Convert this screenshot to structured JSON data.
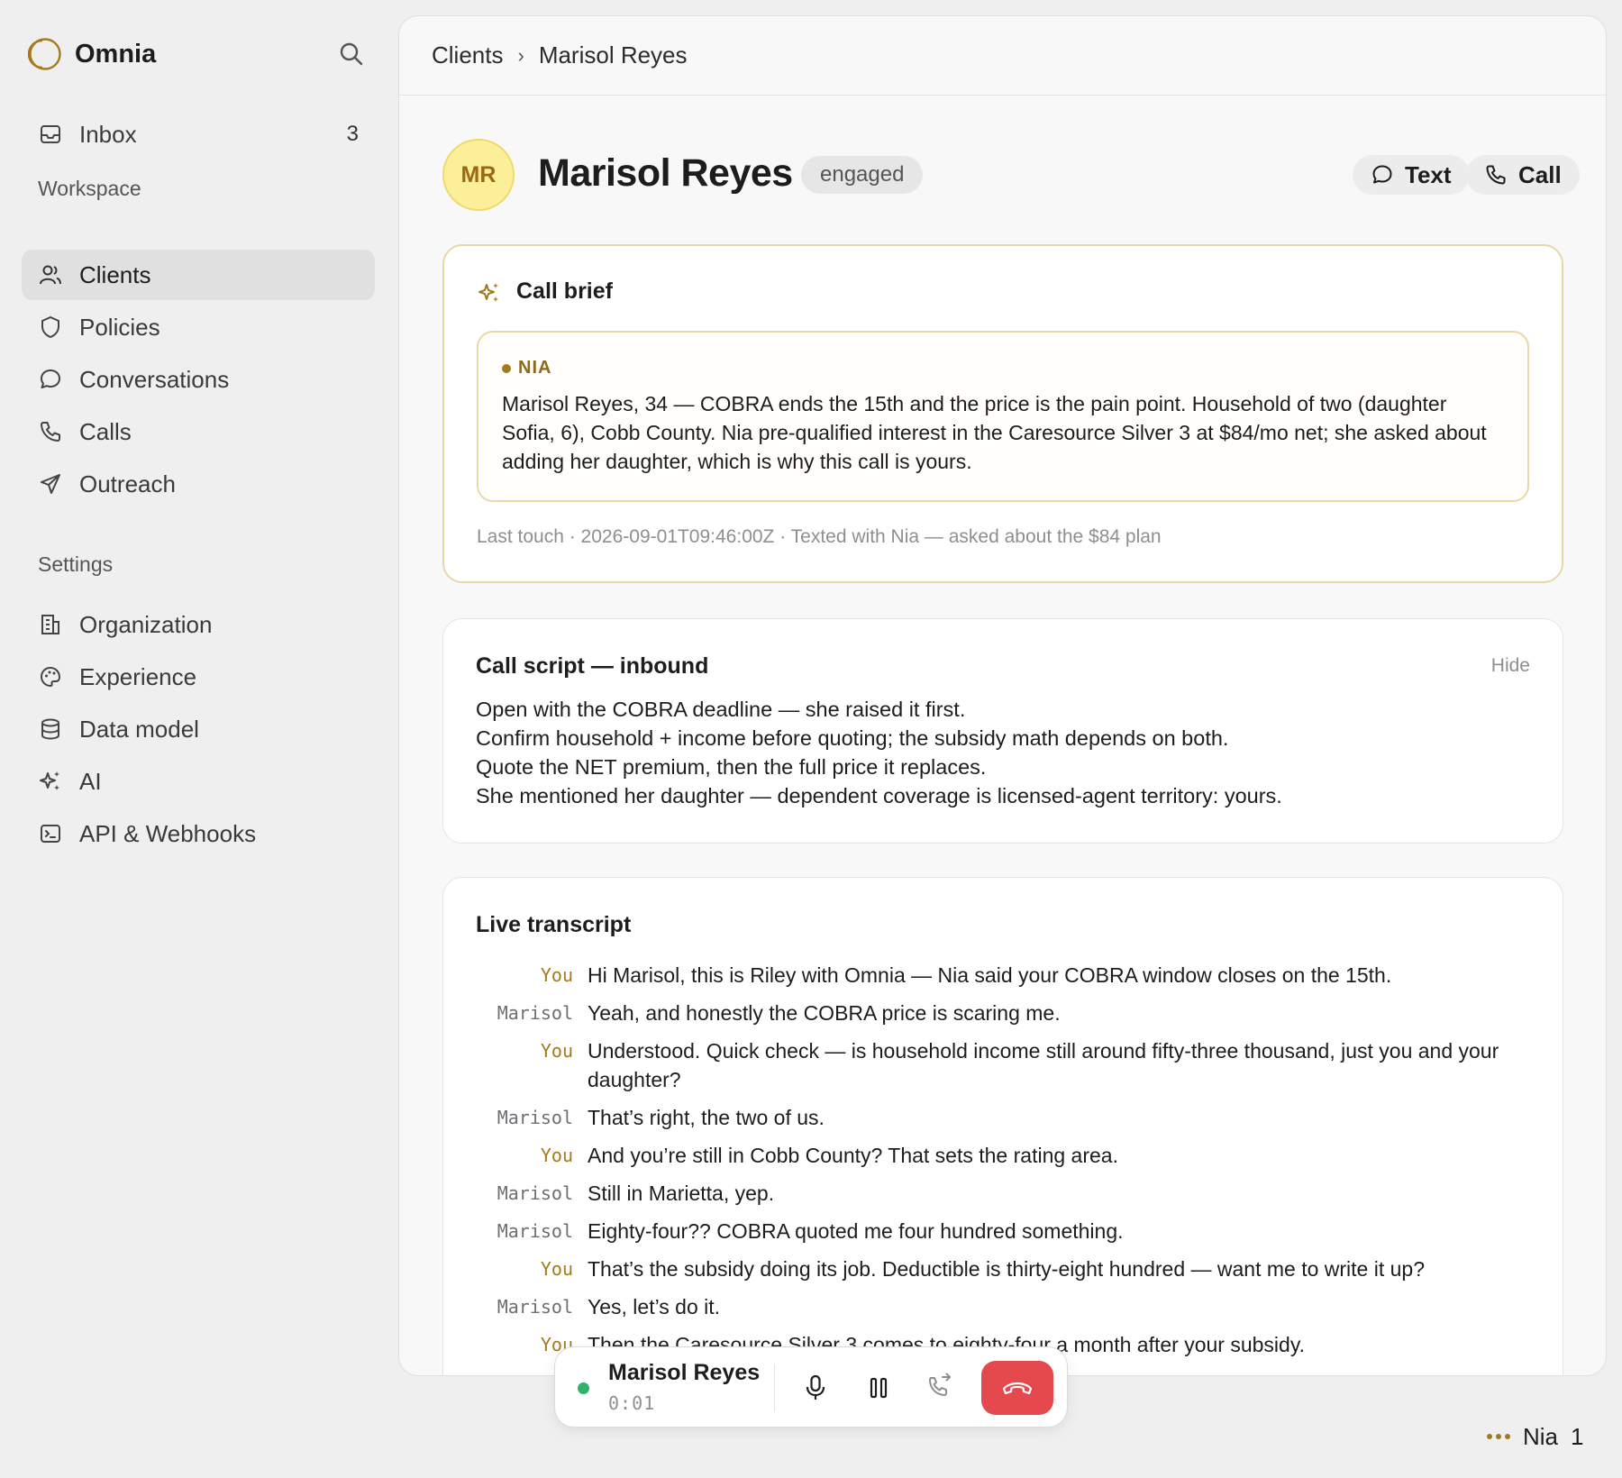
{
  "brand": {
    "name": "Omnia"
  },
  "sidebar": {
    "inbox": {
      "label": "Inbox",
      "count": "3"
    },
    "workspace_label": "Workspace",
    "workspace_items": [
      {
        "label": "Clients",
        "icon": "users-icon",
        "active": true
      },
      {
        "label": "Policies",
        "icon": "shield-icon"
      },
      {
        "label": "Conversations",
        "icon": "chat-bubble-icon"
      },
      {
        "label": "Calls",
        "icon": "phone-icon"
      },
      {
        "label": "Outreach",
        "icon": "send-icon"
      }
    ],
    "settings_label": "Settings",
    "settings_items": [
      {
        "label": "Organization",
        "icon": "building-icon"
      },
      {
        "label": "Experience",
        "icon": "palette-icon"
      },
      {
        "label": "Data model",
        "icon": "database-icon"
      },
      {
        "label": "AI",
        "icon": "sparkles-icon"
      },
      {
        "label": "API & Webhooks",
        "icon": "terminal-icon"
      }
    ]
  },
  "breadcrumb": {
    "parent": "Clients",
    "separator": "›",
    "current": "Marisol Reyes"
  },
  "client": {
    "initials": "MR",
    "name": "Marisol Reyes",
    "status": "engaged",
    "text_label": "Text",
    "call_label": "Call"
  },
  "brief": {
    "title": "Call brief",
    "agent_tag": "NIA",
    "text": "Marisol Reyes, 34 — COBRA ends the 15th and the price is the pain point. Household of two (daughter Sofia, 6), Cobb County. Nia pre-qualified interest in the Caresource Silver 3 at $84/mo net; she asked about adding her daughter, which is why this call is yours.",
    "last_touch": "Last touch · 2026-09-01T09:46:00Z · Texted with Nia — asked about the $84 plan"
  },
  "script": {
    "title": "Call script — inbound",
    "hide_label": "Hide",
    "lines": [
      "Open with the COBRA deadline — she raised it first.",
      "Confirm household + income before quoting; the subsidy math depends on both.",
      "Quote the NET premium, then the full price it replaces.",
      "She mentioned her daughter — dependent coverage is licensed-agent territory: yours."
    ]
  },
  "transcript": {
    "title": "Live transcript",
    "lines": [
      {
        "speaker": "You",
        "role": "you",
        "text": "Hi Marisol, this is Riley with Omnia — Nia said your COBRA window closes on the 15th."
      },
      {
        "speaker": "Marisol",
        "role": "client",
        "text": "Yeah, and honestly the COBRA price is scaring me."
      },
      {
        "speaker": "You",
        "role": "you",
        "text": "Understood. Quick check — is household income still around fifty-three thousand, just you and your daughter?"
      },
      {
        "speaker": "Marisol",
        "role": "client",
        "text": "That’s right, the two of us."
      },
      {
        "speaker": "You",
        "role": "you",
        "text": "And you’re still in Cobb County? That sets the rating area."
      },
      {
        "speaker": "Marisol",
        "role": "client",
        "text": "Still in Marietta, yep."
      },
      {
        "speaker": "Marisol",
        "role": "client",
        "text": "Eighty-four?? COBRA quoted me four hundred something."
      },
      {
        "speaker": "You",
        "role": "you",
        "text": "That’s the subsidy doing its job. Deductible is thirty-eight hundred — want me to write it up?"
      },
      {
        "speaker": "Marisol",
        "role": "client",
        "text": "Yes, let’s do it."
      },
      {
        "speaker": "You",
        "role": "you",
        "text": "Then the Caresource Silver 3 comes to eighty-four a month after your subsidy."
      }
    ]
  },
  "call_bar": {
    "name": "Marisol Reyes",
    "elapsed": "0:01"
  },
  "nia_status": {
    "label": "Nia",
    "count": "1"
  },
  "colors": {
    "accent": "#a37a1e",
    "hangup": "#e5484d",
    "live": "#2fb36b"
  }
}
